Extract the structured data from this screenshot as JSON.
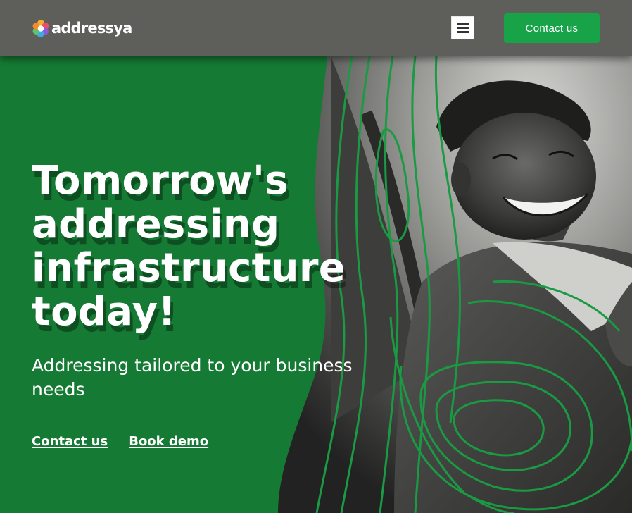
{
  "header": {
    "brand": "addressya",
    "menu_icon": "hamburger-menu-icon",
    "cta_label": "Contact us"
  },
  "hero": {
    "title": "Tomorrow's addressing infrastructure today!",
    "subtitle": "Addressing tailored to your business needs",
    "links": {
      "contact_label": "Contact us",
      "demo_label": "Book demo"
    }
  },
  "colors": {
    "brand_green": "#157a33",
    "button_green": "#18a348",
    "header_bg": "#5e5e5b",
    "contour_line": "#1a9a42"
  }
}
